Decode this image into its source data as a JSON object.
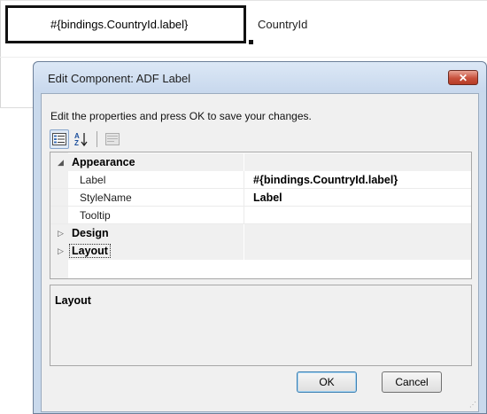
{
  "canvas": {
    "left_cell_text": "#{bindings.CountryId.label}",
    "right_cell_text": "CountryId"
  },
  "dialog": {
    "title": "Edit Component: ADF Label",
    "close_glyph": "✕",
    "instructions": "Edit the properties and press OK to save your changes.",
    "toolbar": {
      "categorized_icon": "categorized-view-icon",
      "alphabetical_icon": "sort-az-icon",
      "property_pages_icon": "property-pages-icon"
    },
    "categories": [
      {
        "name": "Appearance",
        "expanded": true,
        "expand_glyph": "◢",
        "properties": [
          {
            "name": "Label",
            "value": "#{bindings.CountryId.label}"
          },
          {
            "name": "StyleName",
            "value": "Label"
          },
          {
            "name": "Tooltip",
            "value": ""
          }
        ]
      },
      {
        "name": "Design",
        "expanded": false,
        "expand_glyph": "▷"
      },
      {
        "name": "Layout",
        "expanded": false,
        "expand_glyph": "▷"
      }
    ],
    "description": {
      "title": "Layout"
    },
    "buttons": {
      "ok": "OK",
      "cancel": "Cancel"
    },
    "resize_grip": "⋰"
  },
  "colors": {
    "title_bar": "#c8d8ed",
    "close_button": "#c8513c",
    "dialog_body": "#f0f0f0"
  }
}
